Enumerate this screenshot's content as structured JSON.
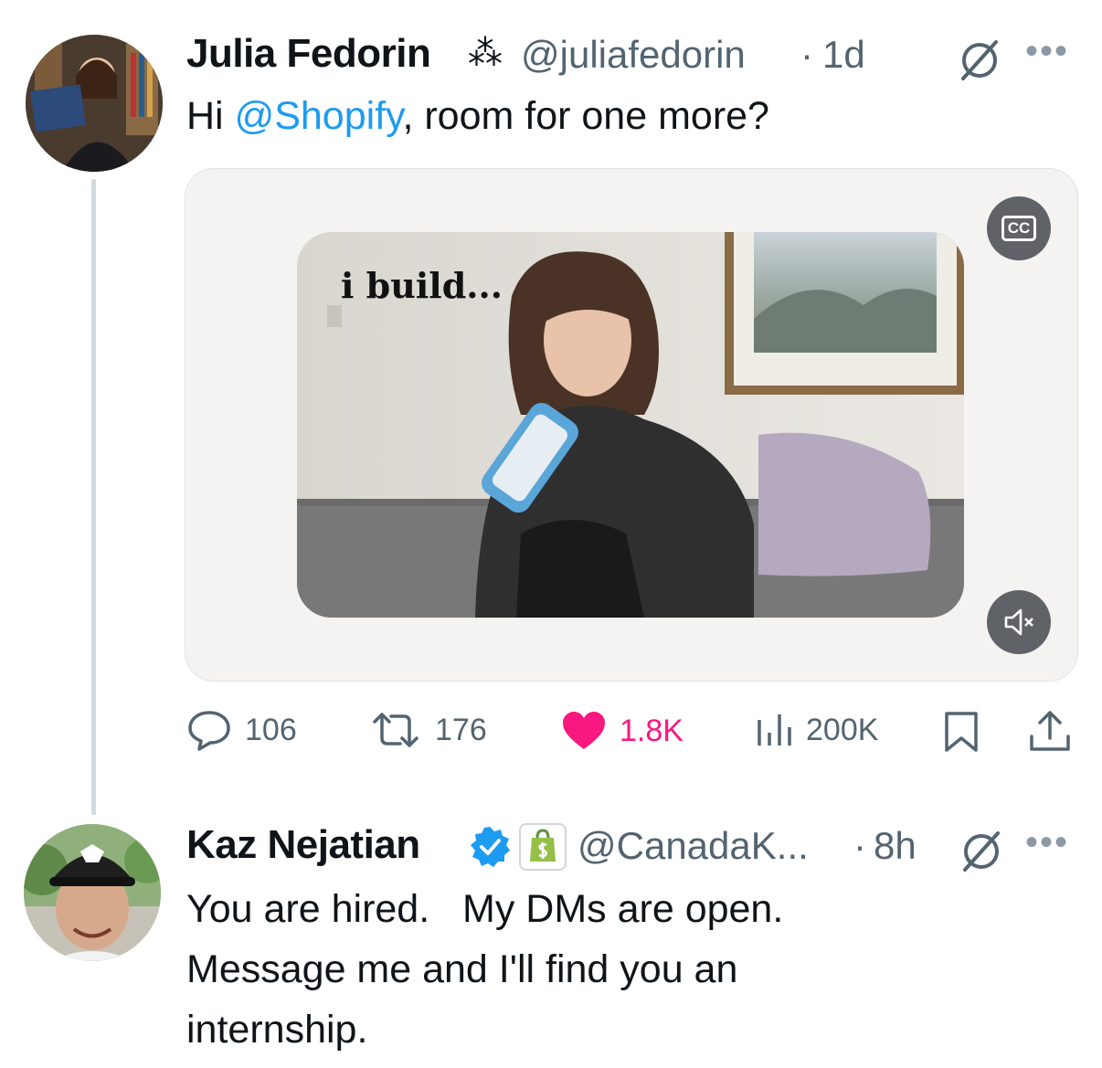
{
  "tweet1": {
    "name": "Julia Fedorin",
    "name_emoji": "⁂",
    "handle": "@juliafedorin",
    "separator": "·",
    "time": "1d",
    "text_before": "Hi ",
    "mention": "@Shopify",
    "text_after": ", room for one more?",
    "media": {
      "overlay_text": "i build...",
      "cc_label": "CC"
    },
    "actions": {
      "replies": "106",
      "reposts": "176",
      "likes": "1.8K",
      "views": "200K"
    },
    "like_color": "#f91880"
  },
  "tweet2": {
    "name": "Kaz Nejatian",
    "handle": "@CanadaK...",
    "separator": "·",
    "time": "8h",
    "line1": "You are hired.   My DMs are open.",
    "line2": "Message me and I'll find you an",
    "line3": "internship."
  },
  "colors": {
    "accent": "#1d9bf0",
    "muted": "#536471",
    "like": "#f91880"
  }
}
